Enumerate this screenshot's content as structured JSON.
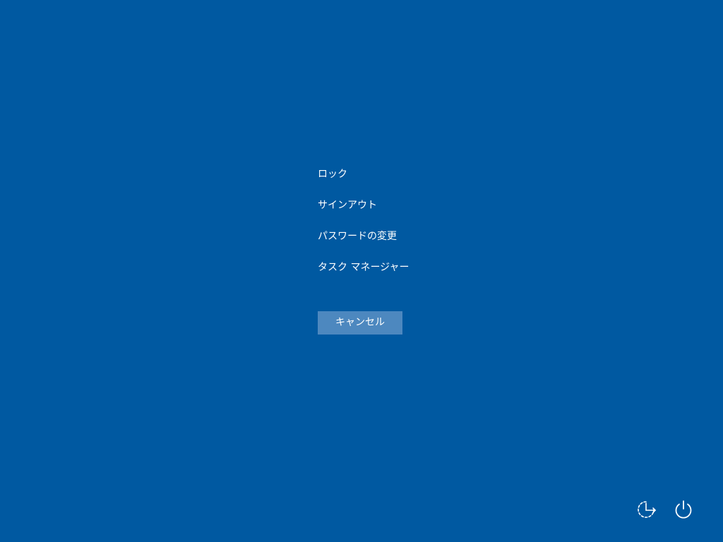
{
  "menu": {
    "items": [
      {
        "label": "ロック"
      },
      {
        "label": "サインアウト"
      },
      {
        "label": "パスワードの変更"
      },
      {
        "label": "タスク マネージャー"
      }
    ]
  },
  "cancel": {
    "label": "キャンセル"
  },
  "icons": {
    "network": "network-sleep-icon",
    "power": "power-icon"
  },
  "colors": {
    "background": "#0059a1",
    "button": "#4d88bf",
    "text": "#ffffff"
  }
}
